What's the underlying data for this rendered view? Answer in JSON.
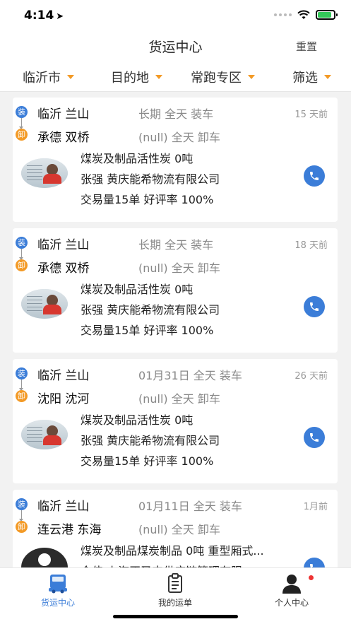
{
  "status": {
    "time": "4:14",
    "battery_level": 0.85,
    "battery_color": "#34c759"
  },
  "nav": {
    "title": "货运中心",
    "reset_label": "重置"
  },
  "filters": [
    {
      "label": "临沂市"
    },
    {
      "label": "目的地"
    },
    {
      "label": "常跑专区"
    },
    {
      "label": "筛选"
    }
  ],
  "tags": {
    "load": "装",
    "unload": "卸"
  },
  "colors": {
    "accent": "#3b7dd8",
    "load_tag": "#3b7dd8",
    "unload_tag": "#f39a26",
    "badge": "#e33"
  },
  "cards": [
    {
      "from_city": "临沂 兰山",
      "from_info": "长期 全天 装车",
      "to_city": "承德 双桥",
      "to_info": "(null) 全天 卸车",
      "ago": "15 天前",
      "cargo": "煤炭及制品活性炭  0吨",
      "company": "张强 黄庆能希物流有限公司",
      "stats": "交易量15单 好评率 100%"
    },
    {
      "from_city": "临沂 兰山",
      "from_info": "长期 全天 装车",
      "to_city": "承德 双桥",
      "to_info": "(null) 全天 卸车",
      "ago": "18 天前",
      "cargo": "煤炭及制品活性炭  0吨",
      "company": "张强 黄庆能希物流有限公司",
      "stats": "交易量15单 好评率 100%"
    },
    {
      "from_city": "临沂 兰山",
      "from_info": "01月31日 全天 装车",
      "to_city": "沈阳 沈河",
      "to_info": "(null) 全天 卸车",
      "ago": "26 天前",
      "cargo": "煤炭及制品活性炭  0吨",
      "company": "张强 黄庆能希物流有限公司",
      "stats": "交易量15单 好评率 100%"
    },
    {
      "from_city": "临沂 兰山",
      "from_info": "01月11日 全天 装车",
      "to_city": "连云港 东海",
      "to_info": "(null) 全天 卸车",
      "ago": "1月前",
      "cargo": "煤炭及制品煤炭制品  0吨 重型厢式...",
      "company": "金伟 上海正圣丰供应链管理有限",
      "stats": ""
    }
  ],
  "tabs": [
    {
      "label": "货运中心",
      "icon": "truck-icon"
    },
    {
      "label": "我的运单",
      "icon": "clipboard-icon"
    },
    {
      "label": "个人中心",
      "icon": "person-icon"
    }
  ]
}
